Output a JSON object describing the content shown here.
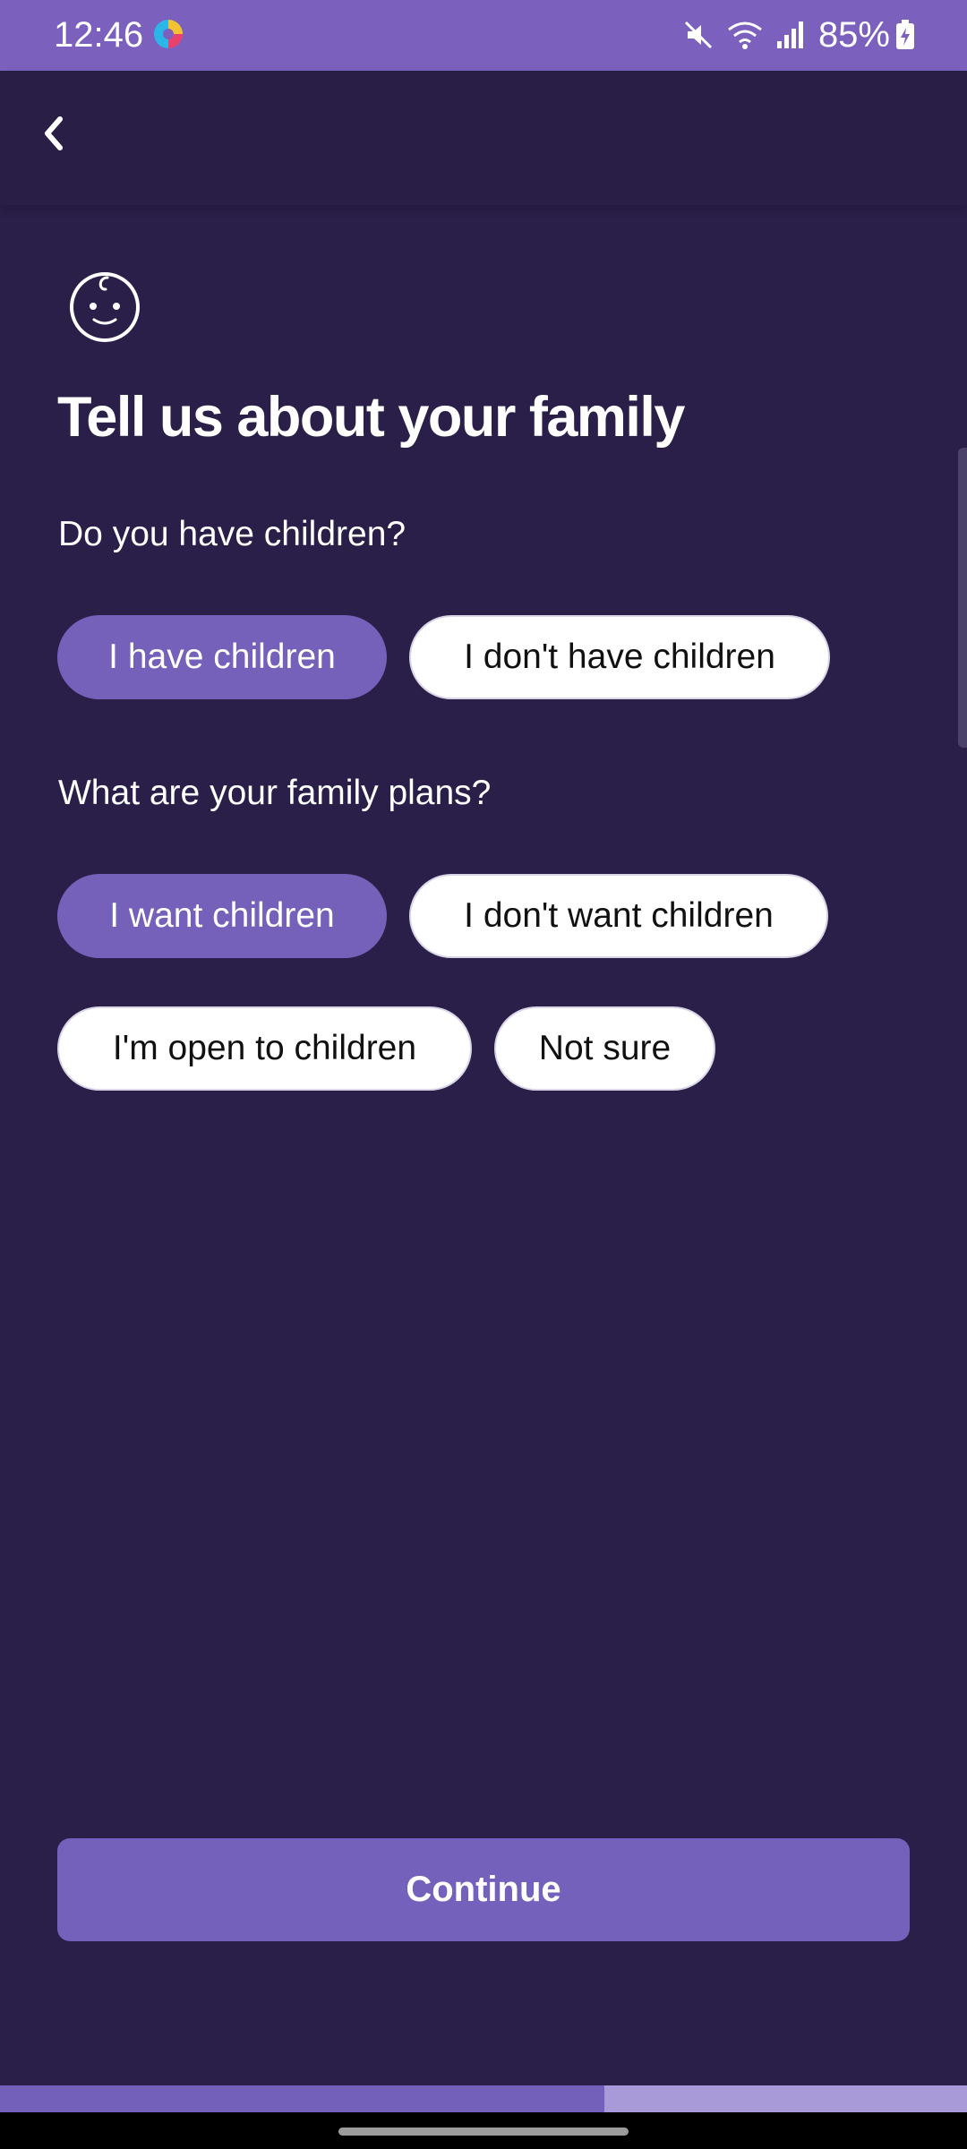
{
  "status_bar": {
    "time": "12:46",
    "battery_percent": "85%",
    "icons": [
      "app-notification-icon",
      "mute-icon",
      "wifi-icon",
      "signal-icon",
      "battery-charging-icon"
    ]
  },
  "app_bar": {
    "back_icon": "chevron-left-icon"
  },
  "content": {
    "header_icon": "baby-face-icon",
    "title": "Tell us about your family",
    "children_question": {
      "label": "Do you have children?",
      "options": [
        {
          "label": "I have children",
          "selected": true
        },
        {
          "label": "I don't have children",
          "selected": false
        }
      ]
    },
    "plans_question": {
      "label": "What are your family plans?",
      "options": [
        {
          "label": "I want children",
          "selected": true
        },
        {
          "label": "I don't want children",
          "selected": false
        },
        {
          "label": "I'm open to children",
          "selected": false
        },
        {
          "label": "Not sure",
          "selected": false
        }
      ]
    }
  },
  "footer": {
    "continue_label": "Continue",
    "progress_fraction": 0.625
  },
  "colors": {
    "background": "#291f48",
    "accent": "#7560ba",
    "status_bar": "#7b61bd",
    "progress_remaining": "#a89ad8",
    "chip_unselected": "#ffffff",
    "text_primary": "#ffffff"
  }
}
